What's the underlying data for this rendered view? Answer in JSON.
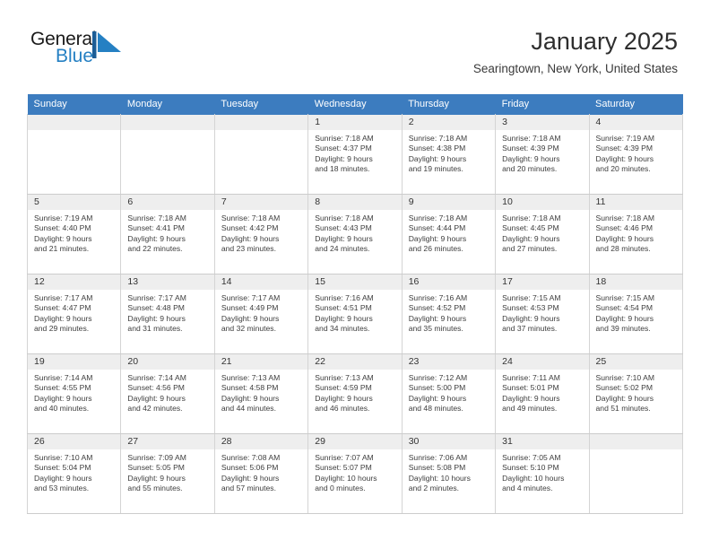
{
  "brand": {
    "name_part1": "General",
    "name_part2": "Blue",
    "flag_icon": "triangle-flag-icon",
    "accent_color": "#2580c3"
  },
  "header": {
    "title": "January 2025",
    "subtitle": "Searingtown, New York, United States"
  },
  "theme": {
    "header_row_color": "#3c7dc0",
    "daynum_band_color": "#eeeeee",
    "border_color": "#d0d0d0",
    "text_color": "#3d3d3d"
  },
  "calendar": {
    "columns": [
      "Sunday",
      "Monday",
      "Tuesday",
      "Wednesday",
      "Thursday",
      "Friday",
      "Saturday"
    ],
    "weeks": [
      [
        {
          "day": "",
          "empty": true,
          "sunrise": "",
          "sunset": "",
          "daylight_line1": "",
          "daylight_line2": ""
        },
        {
          "day": "",
          "empty": true,
          "sunrise": "",
          "sunset": "",
          "daylight_line1": "",
          "daylight_line2": ""
        },
        {
          "day": "",
          "empty": true,
          "sunrise": "",
          "sunset": "",
          "daylight_line1": "",
          "daylight_line2": ""
        },
        {
          "day": "1",
          "sunrise": "Sunrise: 7:18 AM",
          "sunset": "Sunset: 4:37 PM",
          "daylight_line1": "Daylight: 9 hours",
          "daylight_line2": "and 18 minutes."
        },
        {
          "day": "2",
          "sunrise": "Sunrise: 7:18 AM",
          "sunset": "Sunset: 4:38 PM",
          "daylight_line1": "Daylight: 9 hours",
          "daylight_line2": "and 19 minutes."
        },
        {
          "day": "3",
          "sunrise": "Sunrise: 7:18 AM",
          "sunset": "Sunset: 4:39 PM",
          "daylight_line1": "Daylight: 9 hours",
          "daylight_line2": "and 20 minutes."
        },
        {
          "day": "4",
          "sunrise": "Sunrise: 7:19 AM",
          "sunset": "Sunset: 4:39 PM",
          "daylight_line1": "Daylight: 9 hours",
          "daylight_line2": "and 20 minutes."
        }
      ],
      [
        {
          "day": "5",
          "sunrise": "Sunrise: 7:19 AM",
          "sunset": "Sunset: 4:40 PM",
          "daylight_line1": "Daylight: 9 hours",
          "daylight_line2": "and 21 minutes."
        },
        {
          "day": "6",
          "sunrise": "Sunrise: 7:18 AM",
          "sunset": "Sunset: 4:41 PM",
          "daylight_line1": "Daylight: 9 hours",
          "daylight_line2": "and 22 minutes."
        },
        {
          "day": "7",
          "sunrise": "Sunrise: 7:18 AM",
          "sunset": "Sunset: 4:42 PM",
          "daylight_line1": "Daylight: 9 hours",
          "daylight_line2": "and 23 minutes."
        },
        {
          "day": "8",
          "sunrise": "Sunrise: 7:18 AM",
          "sunset": "Sunset: 4:43 PM",
          "daylight_line1": "Daylight: 9 hours",
          "daylight_line2": "and 24 minutes."
        },
        {
          "day": "9",
          "sunrise": "Sunrise: 7:18 AM",
          "sunset": "Sunset: 4:44 PM",
          "daylight_line1": "Daylight: 9 hours",
          "daylight_line2": "and 26 minutes."
        },
        {
          "day": "10",
          "sunrise": "Sunrise: 7:18 AM",
          "sunset": "Sunset: 4:45 PM",
          "daylight_line1": "Daylight: 9 hours",
          "daylight_line2": "and 27 minutes."
        },
        {
          "day": "11",
          "sunrise": "Sunrise: 7:18 AM",
          "sunset": "Sunset: 4:46 PM",
          "daylight_line1": "Daylight: 9 hours",
          "daylight_line2": "and 28 minutes."
        }
      ],
      [
        {
          "day": "12",
          "sunrise": "Sunrise: 7:17 AM",
          "sunset": "Sunset: 4:47 PM",
          "daylight_line1": "Daylight: 9 hours",
          "daylight_line2": "and 29 minutes."
        },
        {
          "day": "13",
          "sunrise": "Sunrise: 7:17 AM",
          "sunset": "Sunset: 4:48 PM",
          "daylight_line1": "Daylight: 9 hours",
          "daylight_line2": "and 31 minutes."
        },
        {
          "day": "14",
          "sunrise": "Sunrise: 7:17 AM",
          "sunset": "Sunset: 4:49 PM",
          "daylight_line1": "Daylight: 9 hours",
          "daylight_line2": "and 32 minutes."
        },
        {
          "day": "15",
          "sunrise": "Sunrise: 7:16 AM",
          "sunset": "Sunset: 4:51 PM",
          "daylight_line1": "Daylight: 9 hours",
          "daylight_line2": "and 34 minutes."
        },
        {
          "day": "16",
          "sunrise": "Sunrise: 7:16 AM",
          "sunset": "Sunset: 4:52 PM",
          "daylight_line1": "Daylight: 9 hours",
          "daylight_line2": "and 35 minutes."
        },
        {
          "day": "17",
          "sunrise": "Sunrise: 7:15 AM",
          "sunset": "Sunset: 4:53 PM",
          "daylight_line1": "Daylight: 9 hours",
          "daylight_line2": "and 37 minutes."
        },
        {
          "day": "18",
          "sunrise": "Sunrise: 7:15 AM",
          "sunset": "Sunset: 4:54 PM",
          "daylight_line1": "Daylight: 9 hours",
          "daylight_line2": "and 39 minutes."
        }
      ],
      [
        {
          "day": "19",
          "sunrise": "Sunrise: 7:14 AM",
          "sunset": "Sunset: 4:55 PM",
          "daylight_line1": "Daylight: 9 hours",
          "daylight_line2": "and 40 minutes."
        },
        {
          "day": "20",
          "sunrise": "Sunrise: 7:14 AM",
          "sunset": "Sunset: 4:56 PM",
          "daylight_line1": "Daylight: 9 hours",
          "daylight_line2": "and 42 minutes."
        },
        {
          "day": "21",
          "sunrise": "Sunrise: 7:13 AM",
          "sunset": "Sunset: 4:58 PM",
          "daylight_line1": "Daylight: 9 hours",
          "daylight_line2": "and 44 minutes."
        },
        {
          "day": "22",
          "sunrise": "Sunrise: 7:13 AM",
          "sunset": "Sunset: 4:59 PM",
          "daylight_line1": "Daylight: 9 hours",
          "daylight_line2": "and 46 minutes."
        },
        {
          "day": "23",
          "sunrise": "Sunrise: 7:12 AM",
          "sunset": "Sunset: 5:00 PM",
          "daylight_line1": "Daylight: 9 hours",
          "daylight_line2": "and 48 minutes."
        },
        {
          "day": "24",
          "sunrise": "Sunrise: 7:11 AM",
          "sunset": "Sunset: 5:01 PM",
          "daylight_line1": "Daylight: 9 hours",
          "daylight_line2": "and 49 minutes."
        },
        {
          "day": "25",
          "sunrise": "Sunrise: 7:10 AM",
          "sunset": "Sunset: 5:02 PM",
          "daylight_line1": "Daylight: 9 hours",
          "daylight_line2": "and 51 minutes."
        }
      ],
      [
        {
          "day": "26",
          "sunrise": "Sunrise: 7:10 AM",
          "sunset": "Sunset: 5:04 PM",
          "daylight_line1": "Daylight: 9 hours",
          "daylight_line2": "and 53 minutes."
        },
        {
          "day": "27",
          "sunrise": "Sunrise: 7:09 AM",
          "sunset": "Sunset: 5:05 PM",
          "daylight_line1": "Daylight: 9 hours",
          "daylight_line2": "and 55 minutes."
        },
        {
          "day": "28",
          "sunrise": "Sunrise: 7:08 AM",
          "sunset": "Sunset: 5:06 PM",
          "daylight_line1": "Daylight: 9 hours",
          "daylight_line2": "and 57 minutes."
        },
        {
          "day": "29",
          "sunrise": "Sunrise: 7:07 AM",
          "sunset": "Sunset: 5:07 PM",
          "daylight_line1": "Daylight: 10 hours",
          "daylight_line2": "and 0 minutes."
        },
        {
          "day": "30",
          "sunrise": "Sunrise: 7:06 AM",
          "sunset": "Sunset: 5:08 PM",
          "daylight_line1": "Daylight: 10 hours",
          "daylight_line2": "and 2 minutes."
        },
        {
          "day": "31",
          "sunrise": "Sunrise: 7:05 AM",
          "sunset": "Sunset: 5:10 PM",
          "daylight_line1": "Daylight: 10 hours",
          "daylight_line2": "and 4 minutes."
        },
        {
          "day": "",
          "empty": true,
          "sunrise": "",
          "sunset": "",
          "daylight_line1": "",
          "daylight_line2": ""
        }
      ]
    ]
  }
}
